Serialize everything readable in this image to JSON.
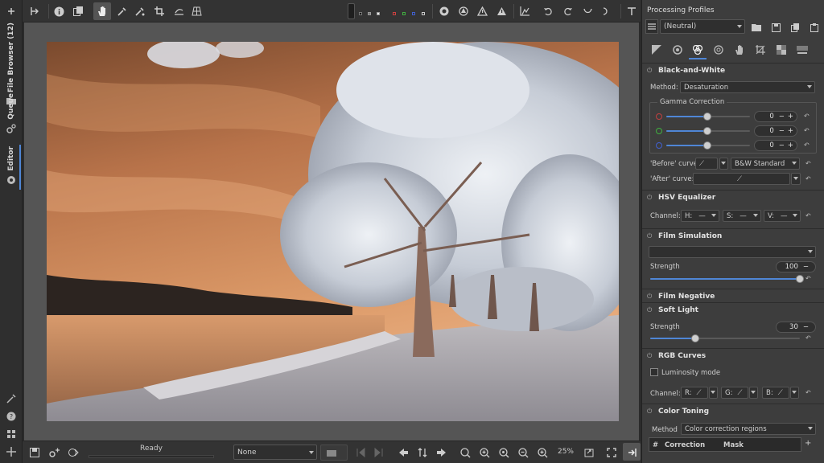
{
  "leftbar": {
    "file_browser": "File Browser (12)",
    "queue": "Queue",
    "editor": "Editor"
  },
  "statusbar": {
    "state": "Ready",
    "preview_mode": "None",
    "zoom": "25%"
  },
  "rpanel": {
    "title": "Processing Profiles",
    "profile": "(Neutral)",
    "bw": {
      "title": "Black-and-White",
      "method_label": "Method:",
      "method_value": "Desaturation",
      "gamma_title": "Gamma Correction",
      "gamma_values": [
        "0",
        "0",
        "0"
      ],
      "before_label": "'Before' curve:",
      "before_value": "B&W Standard",
      "after_label": "'After' curve:"
    },
    "hsv": {
      "title": "HSV Equalizer",
      "channel_label": "Channel:",
      "h": "H:",
      "s": "S:",
      "v": "V:"
    },
    "film_sim": {
      "title": "Film Simulation",
      "strength_label": "Strength",
      "strength_value": "100",
      "strength_level": 1.0
    },
    "film_neg": {
      "title": "Film Negative"
    },
    "soft_light": {
      "title": "Soft Light",
      "strength_label": "Strength",
      "strength_value": "30",
      "strength_level": 0.3
    },
    "rgb": {
      "title": "RGB Curves",
      "luminosity": "Luminosity mode",
      "channel_label": "Channel:",
      "r": "R:",
      "g": "G:",
      "b": "B:"
    },
    "toning": {
      "title": "Color Toning",
      "method_label": "Method",
      "method_value": "Color correction regions",
      "col_hash": "#",
      "col_correction": "Correction",
      "col_mask": "Mask"
    }
  },
  "colors": {
    "accent": "#4f86d6",
    "sky": "#d28a54",
    "panel_bg": "#3d3d3d"
  }
}
